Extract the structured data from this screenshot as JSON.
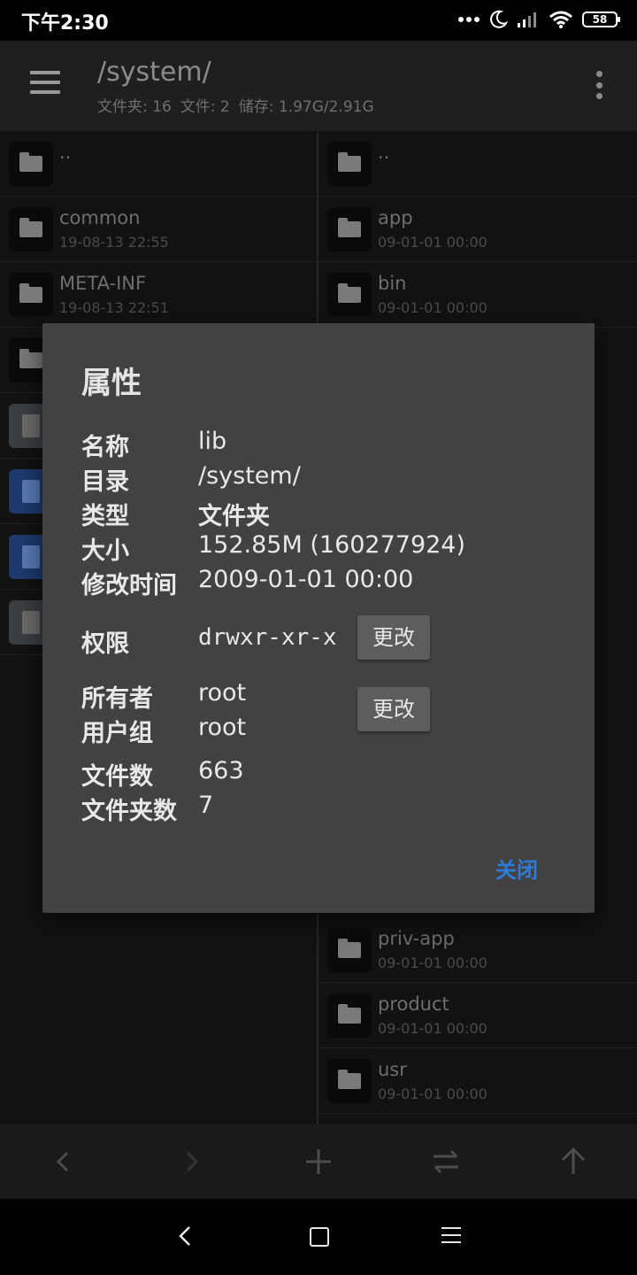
{
  "status_bar": {
    "time": "下午2:30",
    "battery": "58"
  },
  "app_bar": {
    "title": "/system/",
    "folders": "文件夹: 16",
    "files": "文件: 2",
    "storage": "储存: 1.97G/2.91G"
  },
  "left_pane": {
    "items": [
      {
        "name": "..",
        "date": ""
      },
      {
        "name": "common",
        "date": "19-08-13 22:55"
      },
      {
        "name": "META-INF",
        "date": "19-08-13 22:51"
      }
    ]
  },
  "right_pane": {
    "items_top": [
      {
        "name": "..",
        "date": ""
      },
      {
        "name": "app",
        "date": "09-01-01 00:00"
      },
      {
        "name": "bin",
        "date": "09-01-01 00:00"
      }
    ],
    "items_bottom": [
      {
        "name": "priv-app",
        "date": "09-01-01 00:00"
      },
      {
        "name": "product",
        "date": "09-01-01 00:00"
      },
      {
        "name": "usr",
        "date": "09-01-01 00:00"
      }
    ]
  },
  "dialog": {
    "title": "属性",
    "name_label": "名称",
    "name_value": "lib",
    "dir_label": "目录",
    "dir_value": "/system/",
    "type_label": "类型",
    "type_value": "文件夹",
    "size_label": "大小",
    "size_value": "152.85M (160277924)",
    "mtime_label": "修改时间",
    "mtime_value": "2009-01-01 00:00",
    "perm_label": "权限",
    "perm_value": "drwxr-xr-x",
    "owner_label": "所有者",
    "owner_value": "root",
    "group_label": "用户组",
    "group_value": "root",
    "file_count_label": "文件数",
    "file_count_value": "663",
    "folder_count_label": "文件夹数",
    "folder_count_value": "7",
    "change_label": "更改",
    "close_label": "关闭",
    "accent_color": "#2f7ad9"
  },
  "toolbar": {
    "icons": [
      "back-icon",
      "forward-icon",
      "add-icon",
      "swap-icon",
      "up-icon"
    ]
  },
  "nav": {
    "icons": [
      "nav-back-icon",
      "nav-home-icon",
      "nav-recents-icon"
    ]
  }
}
